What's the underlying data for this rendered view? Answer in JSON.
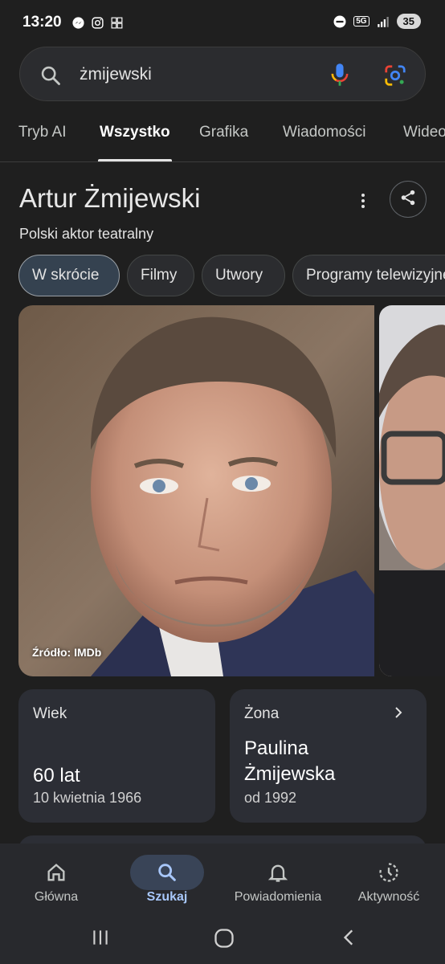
{
  "status": {
    "time": "13:20",
    "network": "5G",
    "battery": "35"
  },
  "search": {
    "query": "żmijewski"
  },
  "tabs": [
    {
      "label": "Tryb AI"
    },
    {
      "label": "Wszystko"
    },
    {
      "label": "Grafika"
    },
    {
      "label": "Wiadomości"
    },
    {
      "label": "Wideo"
    }
  ],
  "knowledge_panel": {
    "title": "Artur Żmijewski",
    "subtitle": "Polski aktor teatralny",
    "chips": [
      {
        "label": "W skrócie"
      },
      {
        "label": "Filmy"
      },
      {
        "label": "Utwory"
      },
      {
        "label": "Programy telewizyjne"
      }
    ],
    "photo_source": "Źródło: IMDb",
    "age_card": {
      "label": "Wiek",
      "value": "60 lat",
      "sub": "10 kwietnia 1966"
    },
    "spouse_card": {
      "label": "Żona",
      "value_line1": "Paulina",
      "value_line2": "Żmijewska",
      "sub": "od 1992"
    }
  },
  "bottom_nav": [
    {
      "label": "Główna",
      "icon": "home-icon"
    },
    {
      "label": "Szukaj",
      "icon": "search-icon"
    },
    {
      "label": "Powiadomienia",
      "icon": "bell-icon"
    },
    {
      "label": "Aktywność",
      "icon": "history-icon"
    }
  ],
  "colors": {
    "background": "#1f1f1f",
    "accent": "#a8c7fa",
    "card": "#2c2e35"
  }
}
